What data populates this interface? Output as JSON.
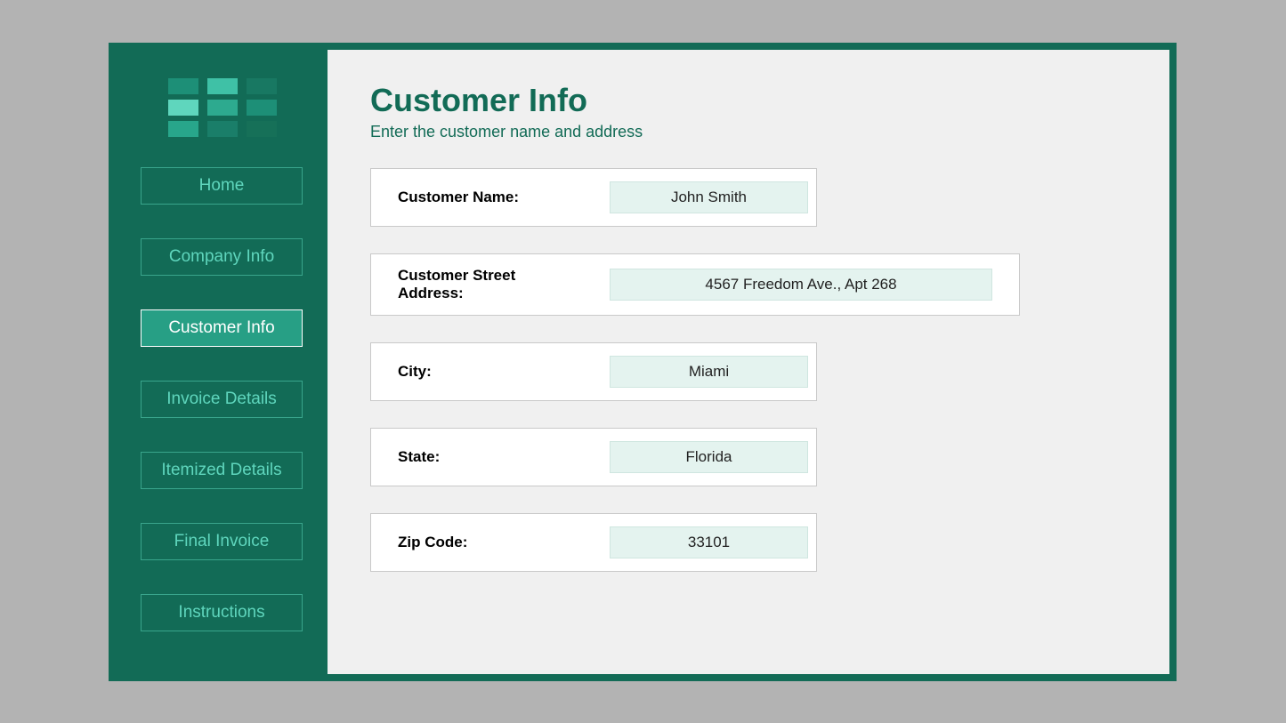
{
  "sidebar": {
    "items": [
      {
        "label": "Home",
        "active": false
      },
      {
        "label": "Company Info",
        "active": false
      },
      {
        "label": "Customer Info",
        "active": true
      },
      {
        "label": "Invoice Details",
        "active": false
      },
      {
        "label": "Itemized Details",
        "active": false
      },
      {
        "label": "Final Invoice",
        "active": false
      },
      {
        "label": "Instructions",
        "active": false
      }
    ]
  },
  "main": {
    "title": "Customer Info",
    "subtitle": "Enter the customer name and address",
    "fields": [
      {
        "label": "Customer Name:",
        "value": "John Smith",
        "wide": false
      },
      {
        "label": "Customer Street Address:",
        "value": "4567 Freedom Ave., Apt 268",
        "wide": true
      },
      {
        "label": "City:",
        "value": "Miami",
        "wide": false
      },
      {
        "label": "State:",
        "value": "Florida",
        "wide": false
      },
      {
        "label": "Zip Code:",
        "value": "33101",
        "wide": false
      }
    ]
  }
}
